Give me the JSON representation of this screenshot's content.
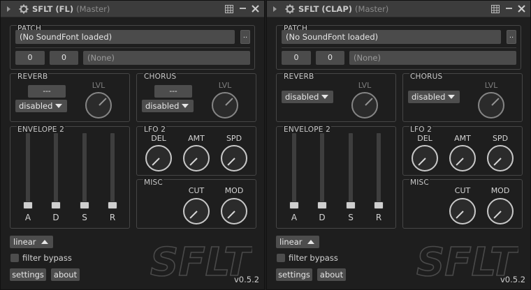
{
  "plugins": [
    {
      "title": "SFLT (FL)",
      "subtitle": "(Master)",
      "patch": {
        "label": "PATCH",
        "soundfont": "(No SoundFont loaded)",
        "browse_label": "..",
        "bank": "0",
        "program": "0",
        "preset": "(None)"
      },
      "reverb": {
        "label": "REVERB",
        "preset": "---",
        "mode": "disabled",
        "level_label": "LVL"
      },
      "chorus": {
        "label": "CHORUS",
        "preset": "---",
        "mode": "disabled",
        "level_label": "LVL"
      },
      "envelope": {
        "label": "ENVELOPE 2",
        "sliders": [
          "A",
          "D",
          "S",
          "R"
        ]
      },
      "lfo": {
        "label": "LFO 2",
        "knobs": [
          "DEL",
          "AMT",
          "SPD"
        ]
      },
      "misc": {
        "label": "MISC",
        "knobs": [
          "CUT",
          "MOD"
        ]
      },
      "curve": "linear",
      "filter_bypass": "filter bypass",
      "settings": "settings",
      "about": "about",
      "logo": "SFLT",
      "version": "v0.5.2"
    },
    {
      "title": "SFLT (CLAP)",
      "subtitle": "(Master)",
      "patch": {
        "label": "PATCH",
        "soundfont": "(No SoundFont loaded)",
        "browse_label": "..",
        "bank": "0",
        "program": "0",
        "preset": "(None)"
      },
      "reverb": {
        "label": "REVERB",
        "mode": "disabled",
        "level_label": "LVL"
      },
      "chorus": {
        "label": "CHORUS",
        "mode": "disabled",
        "level_label": "LVL"
      },
      "envelope": {
        "label": "ENVELOPE 2",
        "sliders": [
          "A",
          "D",
          "S",
          "R"
        ]
      },
      "lfo": {
        "label": "LFO 2",
        "knobs": [
          "DEL",
          "AMT",
          "SPD"
        ]
      },
      "misc": {
        "label": "MISC",
        "knobs": [
          "CUT",
          "MOD"
        ]
      },
      "curve": "linear",
      "filter_bypass": "filter bypass",
      "settings": "settings",
      "about": "about",
      "logo": "SFLT",
      "version": "v0.5.2"
    }
  ],
  "icons": {
    "expand": "expand-arrow-icon",
    "gear": "gear-icon",
    "grid": "grid-icon",
    "minimize": "minimize-icon",
    "close": "close-icon"
  },
  "colors": {
    "background": "#1e1e1e",
    "titlebar": "#3c3c3c",
    "control": "#4b4b4b",
    "knob_ring": "#c8c8c8"
  }
}
